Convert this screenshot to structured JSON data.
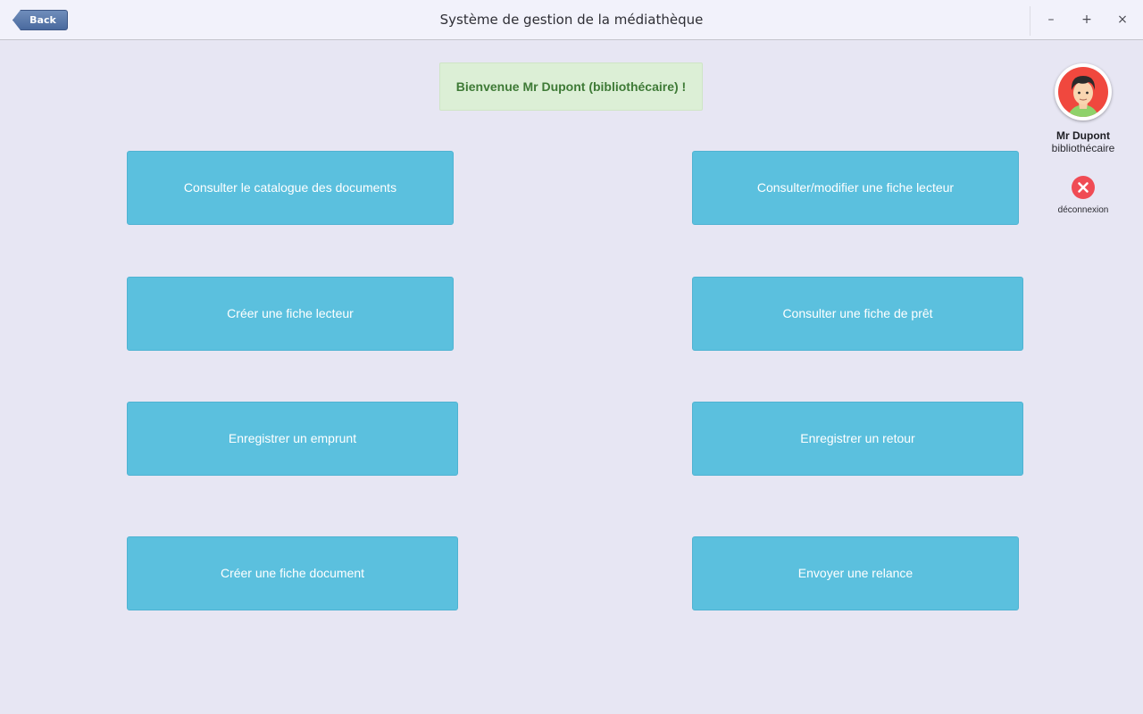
{
  "window": {
    "title": "Système de gestion de la médiathèque",
    "back_label": "Back",
    "minimize_glyph": "–",
    "maximize_glyph": "+",
    "close_glyph": "×"
  },
  "welcome": {
    "message": "Bienvenue Mr Dupont (bibliothécaire) !"
  },
  "actions": {
    "consult_catalogue": "Consulter le catalogue des documents",
    "create_reader_card": "Créer une fiche lecteur",
    "register_loan": "Enregistrer un emprunt",
    "create_document_card": "Créer une fiche document",
    "consult_modify_reader_card": "Consulter/modifier une fiche lecteur",
    "consult_loan_card": "Consulter une fiche de prêt",
    "register_return": "Enregistrer un retour",
    "send_reminder": "Envoyer une relance"
  },
  "user": {
    "name": "Mr Dupont",
    "role": "bibliothécaire",
    "logout_label": "déconnexion",
    "avatar_icon": "user-avatar-icon",
    "logout_icon": "close-circle-icon"
  },
  "colors": {
    "background": "#e7e6f3",
    "action_button": "#5bc0de",
    "welcome_banner": "#dcefd6",
    "welcome_text": "#3e7a36",
    "logout_icon": "#f04b54",
    "back_button": "#5677aa"
  }
}
